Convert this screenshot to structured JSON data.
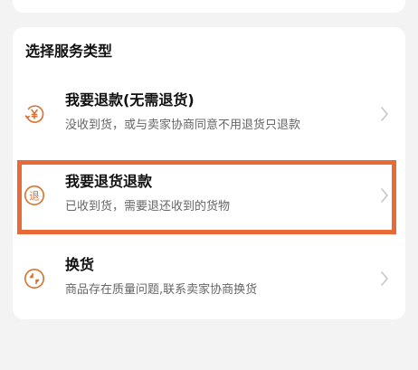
{
  "section": {
    "title": "选择服务类型"
  },
  "options": [
    {
      "icon": "yen-refund-icon",
      "title": "我要退款(无需退货)",
      "desc": "没收到货，或与卖家协商同意不用退货只退款"
    },
    {
      "icon": "return-refund-icon",
      "title": "我要退货退款",
      "desc": "已收到货，需要退还收到的货物",
      "icon_text": "退"
    },
    {
      "icon": "exchange-icon",
      "title": "换货",
      "desc": "商品存在质量问题,联系卖家协商换货"
    }
  ],
  "colors": {
    "accent": "#e86a37",
    "icon": "#d9702f",
    "highlight": "#e86a37"
  }
}
